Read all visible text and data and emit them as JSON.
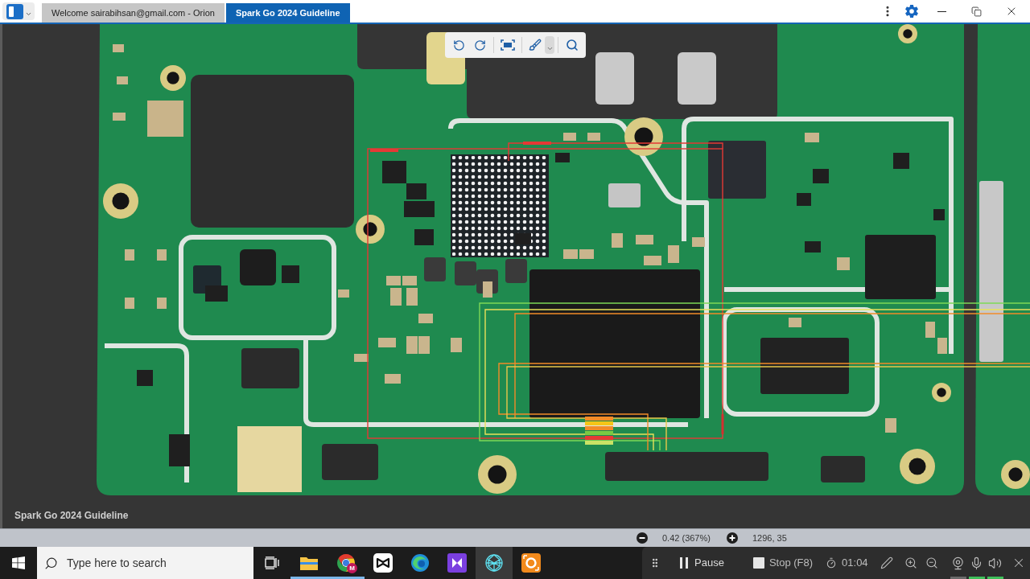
{
  "window": {
    "tabs": [
      {
        "label": "Welcome sairabihsan@gmail.com - Orion",
        "selected": false
      },
      {
        "label": "Spark Go 2024 Guideline",
        "selected": true
      }
    ]
  },
  "viewer": {
    "caption": "Spark Go 2024 Guideline"
  },
  "status_bar": {
    "zoom": "0.42 (367%)",
    "coordinates": "1296, 35"
  },
  "taskbar": {
    "search": {
      "placeholder": "Type here to search"
    },
    "apps": [
      {
        "kind": "folder",
        "selected": false,
        "running": true
      },
      {
        "kind": "colorwheel",
        "badge": "M",
        "selected": false,
        "running": true
      },
      {
        "kind": "bowtie",
        "selected": false,
        "running": false
      },
      {
        "kind": "swirl",
        "selected": false,
        "running": false
      },
      {
        "kind": "play",
        "selected": false,
        "running": false
      },
      {
        "kind": "network",
        "selected": true,
        "running": false
      },
      {
        "kind": "ring",
        "selected": false,
        "running": false
      }
    ]
  },
  "recorder": {
    "pause": "Pause",
    "stop": "Stop (F8)",
    "timer": "01:04",
    "devices": [
      {
        "kind": "webcam",
        "on": false
      },
      {
        "kind": "microphone",
        "on": true
      },
      {
        "kind": "speaker",
        "on": true
      }
    ]
  }
}
